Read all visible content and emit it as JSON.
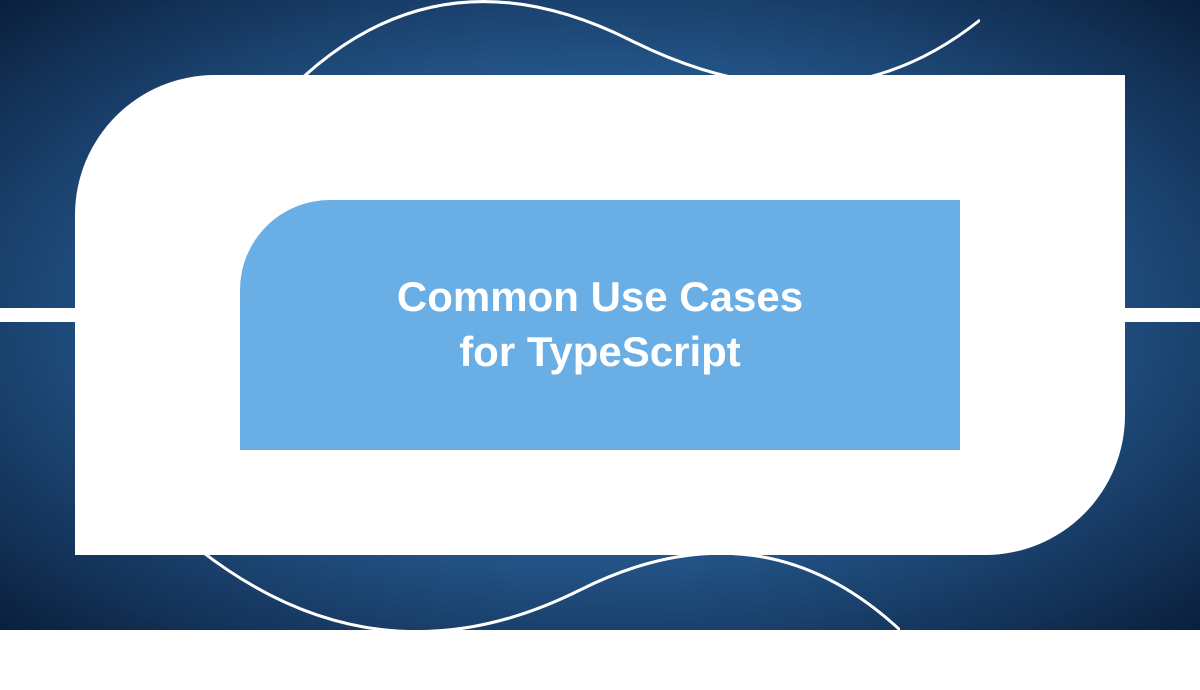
{
  "title_line1": "Common Use Cases",
  "title_line2": "for TypeScript"
}
